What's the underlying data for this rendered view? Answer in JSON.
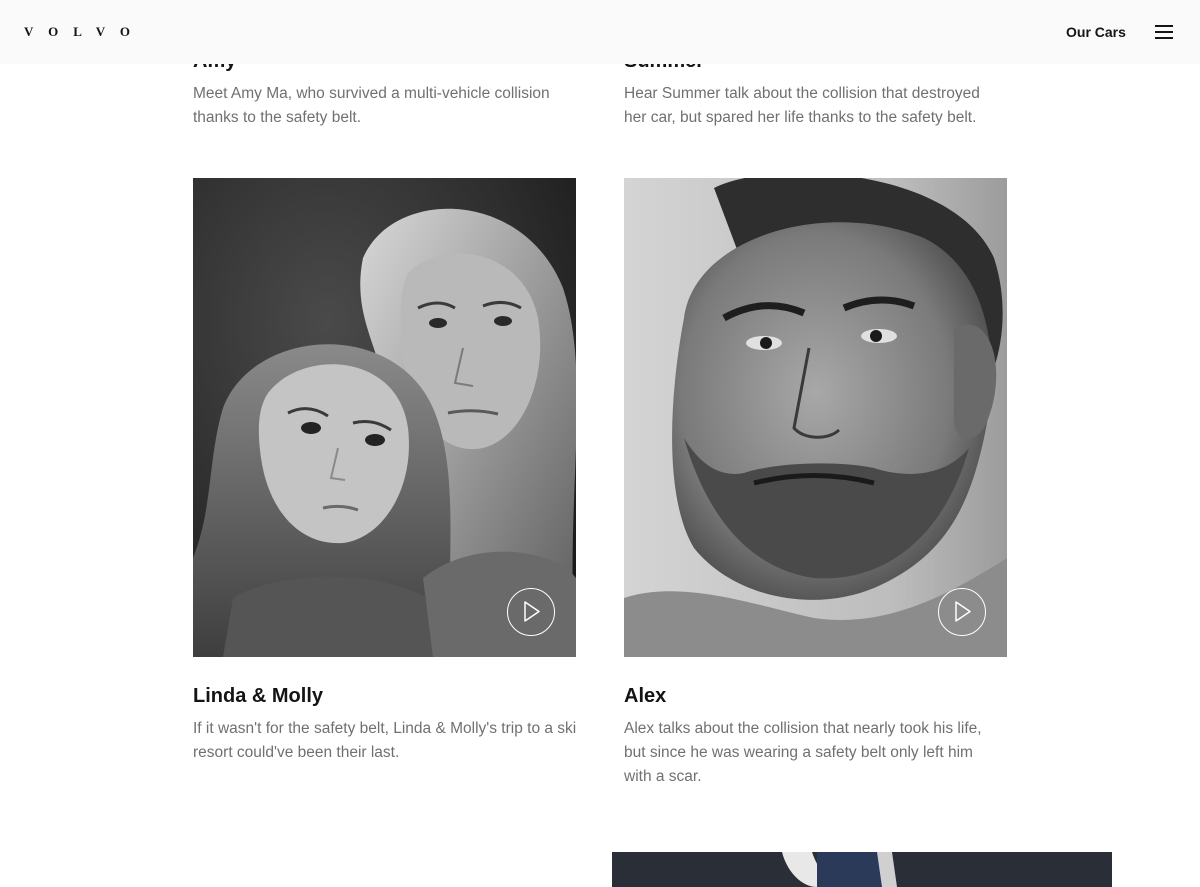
{
  "header": {
    "brand": "VOLVO",
    "nav_our_cars": "Our Cars",
    "menu_icon": "hamburger-menu-icon"
  },
  "stories": [
    {
      "title": "Amy",
      "description": "Meet Amy Ma, who survived a multi-vehicle collision thanks to the safety belt."
    },
    {
      "title": "Summer",
      "description": "Hear Summer talk about the collision that destroyed her car, but spared her life thanks to the safety belt."
    },
    {
      "title": "Linda & Molly",
      "description": "If it wasn't for the safety belt, Linda & Molly's trip to a ski resort could've been their last.",
      "image_icon": "portrait-linda-molly",
      "play_icon": "play-icon"
    },
    {
      "title": "Alex",
      "description": "Alex talks about the collision that nearly took his life, but since he was wearing a safety belt only left him with a scar.",
      "image_icon": "portrait-alex",
      "play_icon": "play-icon"
    }
  ],
  "colors": {
    "header_bg": "#fafafa",
    "text_primary": "#141414",
    "text_secondary": "#707070"
  }
}
